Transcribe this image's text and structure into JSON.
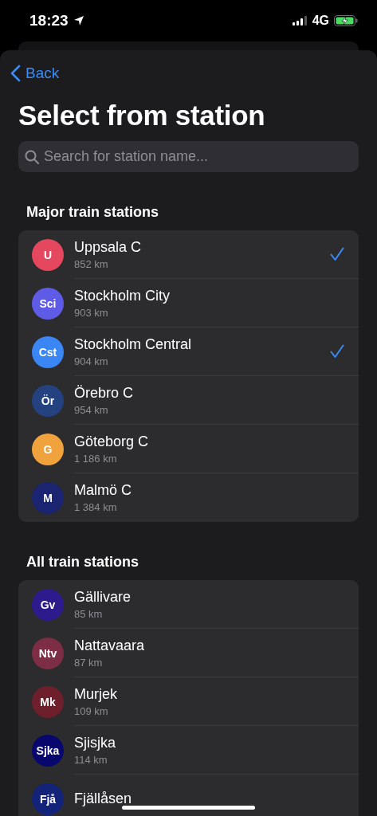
{
  "status_bar": {
    "time": "18:23",
    "network": "4G"
  },
  "back": {
    "label": "Back"
  },
  "title": "Select from station",
  "search": {
    "placeholder": "Search for station name..."
  },
  "sections": [
    {
      "header": "Major train stations",
      "stations": [
        {
          "abbr": "U",
          "name": "Uppsala C",
          "distance": "852 km",
          "color": "#e5475e",
          "selected": true
        },
        {
          "abbr": "Sci",
          "name": "Stockholm City",
          "distance": "903 km",
          "color": "#5e5ce6",
          "selected": false
        },
        {
          "abbr": "Cst",
          "name": "Stockholm Central",
          "distance": "904 km",
          "color": "#3a86f5",
          "selected": true
        },
        {
          "abbr": "Ör",
          "name": "Örebro C",
          "distance": "954 km",
          "color": "#24427f",
          "selected": false
        },
        {
          "abbr": "G",
          "name": "Göteborg C",
          "distance": "1 186 km",
          "color": "#f0a33c",
          "selected": false
        },
        {
          "abbr": "M",
          "name": "Malmö C",
          "distance": "1 384 km",
          "color": "#1a2470",
          "selected": false
        }
      ]
    },
    {
      "header": "All train stations",
      "stations": [
        {
          "abbr": "Gv",
          "name": "Gällivare",
          "distance": "85 km",
          "color": "#2d1a8c",
          "selected": false
        },
        {
          "abbr": "Ntv",
          "name": "Nattavaara",
          "distance": "87 km",
          "color": "#7d2e45",
          "selected": false
        },
        {
          "abbr": "Mk",
          "name": "Murjek",
          "distance": "109 km",
          "color": "#6e1f2c",
          "selected": false
        },
        {
          "abbr": "Sjka",
          "name": "Sjisjka",
          "distance": "114 km",
          "color": "#07076e",
          "selected": false
        },
        {
          "abbr": "Fjå",
          "name": "Fjällåsen",
          "color": "#14237a",
          "selected": false
        }
      ]
    }
  ]
}
